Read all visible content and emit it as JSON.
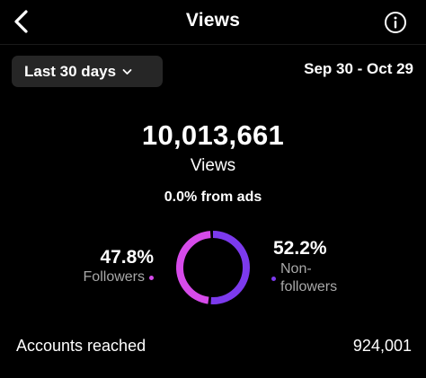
{
  "header": {
    "title": "Views",
    "back_icon": "chevron-left-icon",
    "info_icon": "info-icon"
  },
  "filter": {
    "range_label": "Last 30 days",
    "chevron_icon": "chevron-down-icon",
    "date_range": "Sep 30 - Oct 29"
  },
  "summary": {
    "total_views": "10,013,661",
    "total_label": "Views",
    "ads_text": "0.0% from ads"
  },
  "breakdown": {
    "followers_pct_text": "47.8%",
    "followers_label": "Followers",
    "followers_fraction": 0.478,
    "nonfollowers_pct_text": "52.2%",
    "nonfollowers_label": "Non-followers",
    "nonfollowers_label_line1": "Non-",
    "nonfollowers_label_line2": "followers",
    "nonfollowers_fraction": 0.522
  },
  "colors": {
    "followers": "#d64bea",
    "nonfollowers": "#7c3aed",
    "background": "#000000",
    "muted_text": "#a8a8a8"
  },
  "accounts_reached": {
    "label": "Accounts reached",
    "value": "924,001"
  }
}
